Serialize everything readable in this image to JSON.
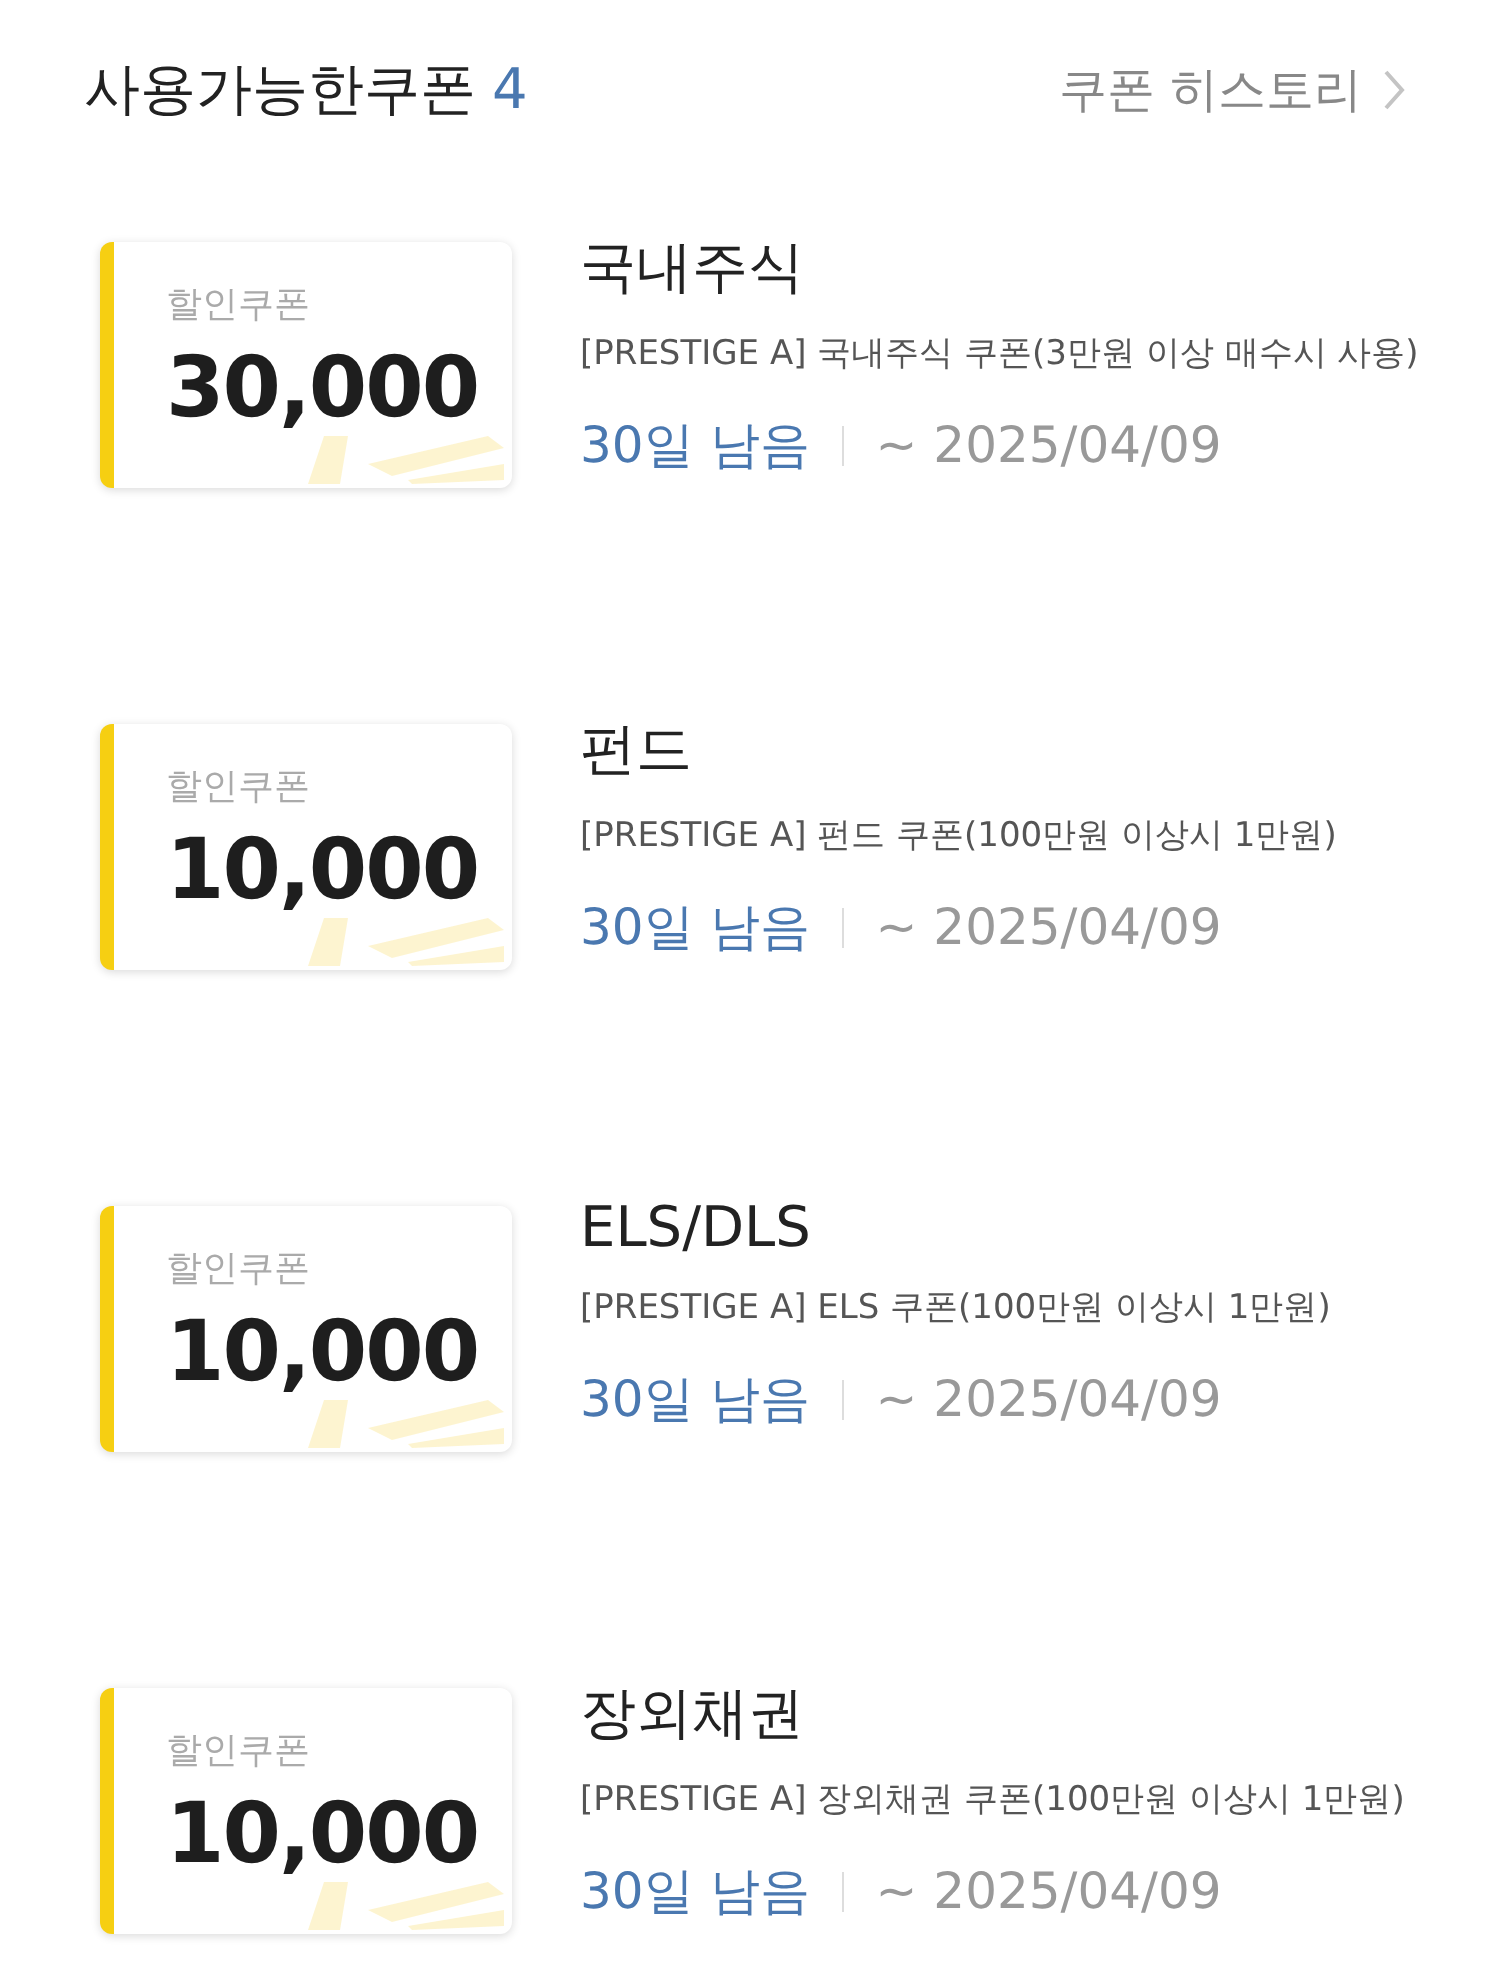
{
  "header": {
    "title": "사용가능한쿠폰",
    "count": "4",
    "history_link": "쿠폰 히스토리"
  },
  "coupons": [
    {
      "type_label": "할인쿠폰",
      "amount": "30,000",
      "name": "국내주식",
      "description": "[PRESTIGE A] 국내주식 쿠폰(3만원 이상 매수시 사용)",
      "remaining": "30일 남음",
      "expiry": "~ 2025/04/09"
    },
    {
      "type_label": "할인쿠폰",
      "amount": "10,000",
      "name": "펀드",
      "description": "[PRESTIGE A] 펀드 쿠폰(100만원 이상시 1만원)",
      "remaining": "30일 남음",
      "expiry": "~ 2025/04/09"
    },
    {
      "type_label": "할인쿠폰",
      "amount": "10,000",
      "name": "ELS/DLS",
      "description": "[PRESTIGE A] ELS 쿠폰(100만원 이상시 1만원)",
      "remaining": "30일 남음",
      "expiry": "~ 2025/04/09"
    },
    {
      "type_label": "할인쿠폰",
      "amount": "10,000",
      "name": "장외채권",
      "description": "[PRESTIGE A] 장외채권 쿠폰(100만원 이상시 1만원)",
      "remaining": "30일 남음",
      "expiry": "~ 2025/04/09"
    }
  ]
}
